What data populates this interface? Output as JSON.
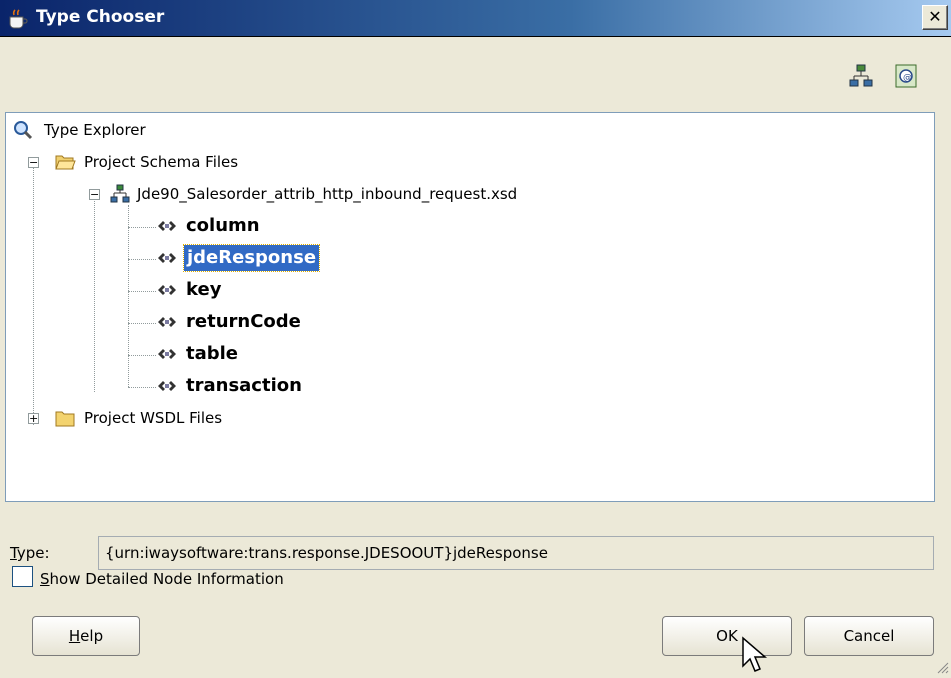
{
  "window": {
    "title": "Type Chooser",
    "close_glyph": "✕"
  },
  "toolbar": {
    "icons": [
      "hierarchy-icon",
      "web-service-icon"
    ]
  },
  "tree": {
    "root": {
      "label": "Type Explorer",
      "icon": "magnifier-icon"
    },
    "schema_folder": {
      "label": "Project Schema Files",
      "expanded_glyph": "−"
    },
    "xsd_file": {
      "label": "Jde90_Salesorder_attrib_http_inbound_request.xsd",
      "expanded_glyph": "−"
    },
    "elements": [
      {
        "label": "column",
        "selected": false
      },
      {
        "label": "jdeResponse",
        "selected": true
      },
      {
        "label": "key",
        "selected": false
      },
      {
        "label": "returnCode",
        "selected": false
      },
      {
        "label": "table",
        "selected": false
      },
      {
        "label": "transaction",
        "selected": false
      }
    ],
    "wsdl_folder": {
      "label": "Project WSDL Files",
      "collapsed_glyph": "+"
    }
  },
  "type_field": {
    "label_prefix": "T",
    "label_rest": "ype:",
    "value": "{urn:iwaysoftware:trans.response.JDESOOUT}jdeResponse"
  },
  "options": {
    "show_detail_prefix": "S",
    "show_detail_rest": "how Detailed Node Information",
    "checked": false
  },
  "buttons": {
    "help_prefix": "H",
    "help_rest": "elp",
    "ok": "OK",
    "cancel": "Cancel"
  },
  "colors": {
    "selection": "#316ac5",
    "title_start": "#0a246a",
    "title_end": "#a6caf0"
  }
}
